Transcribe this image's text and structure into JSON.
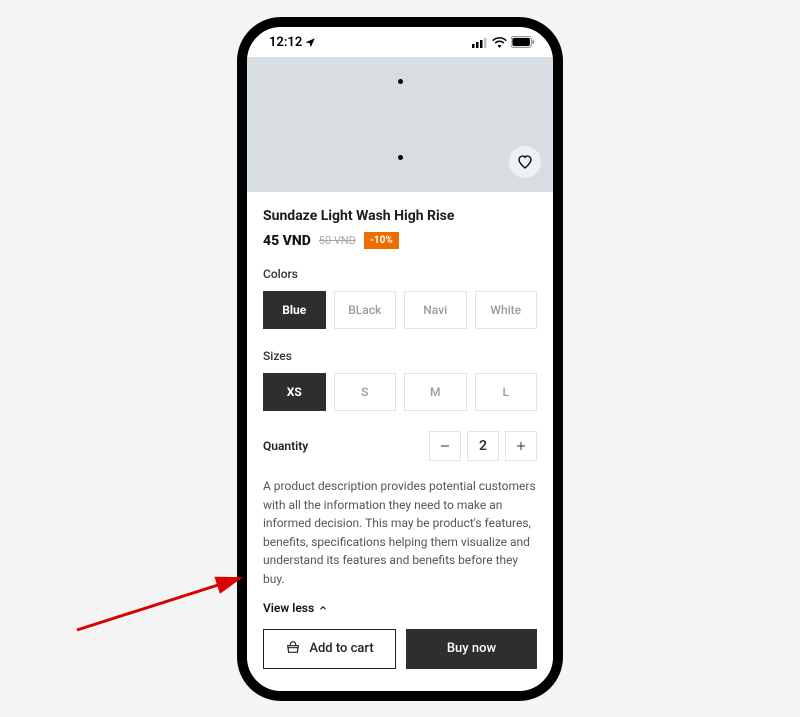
{
  "status": {
    "time": "12:12"
  },
  "product": {
    "title": "Sundaze Light Wash High Rise",
    "price": "45 VND",
    "old_price": "50 VND",
    "discount": "-10%"
  },
  "colors": {
    "label": "Colors",
    "options": [
      "Blue",
      "BLack",
      "Navi",
      "White"
    ],
    "selected": "Blue"
  },
  "sizes": {
    "label": "Sizes",
    "options": [
      "XS",
      "S",
      "M",
      "L"
    ],
    "selected": "XS"
  },
  "quantity": {
    "label": "Quantity",
    "value": "2"
  },
  "description": "A product description provides potential customers with all the information they need to make an informed decision. This may be product's features, benefits, specifications helping them visualize and understand its features and benefits before they buy.",
  "view_less": "View less",
  "cta": {
    "add_to_cart": "Add to cart",
    "buy_now": "Buy now"
  }
}
